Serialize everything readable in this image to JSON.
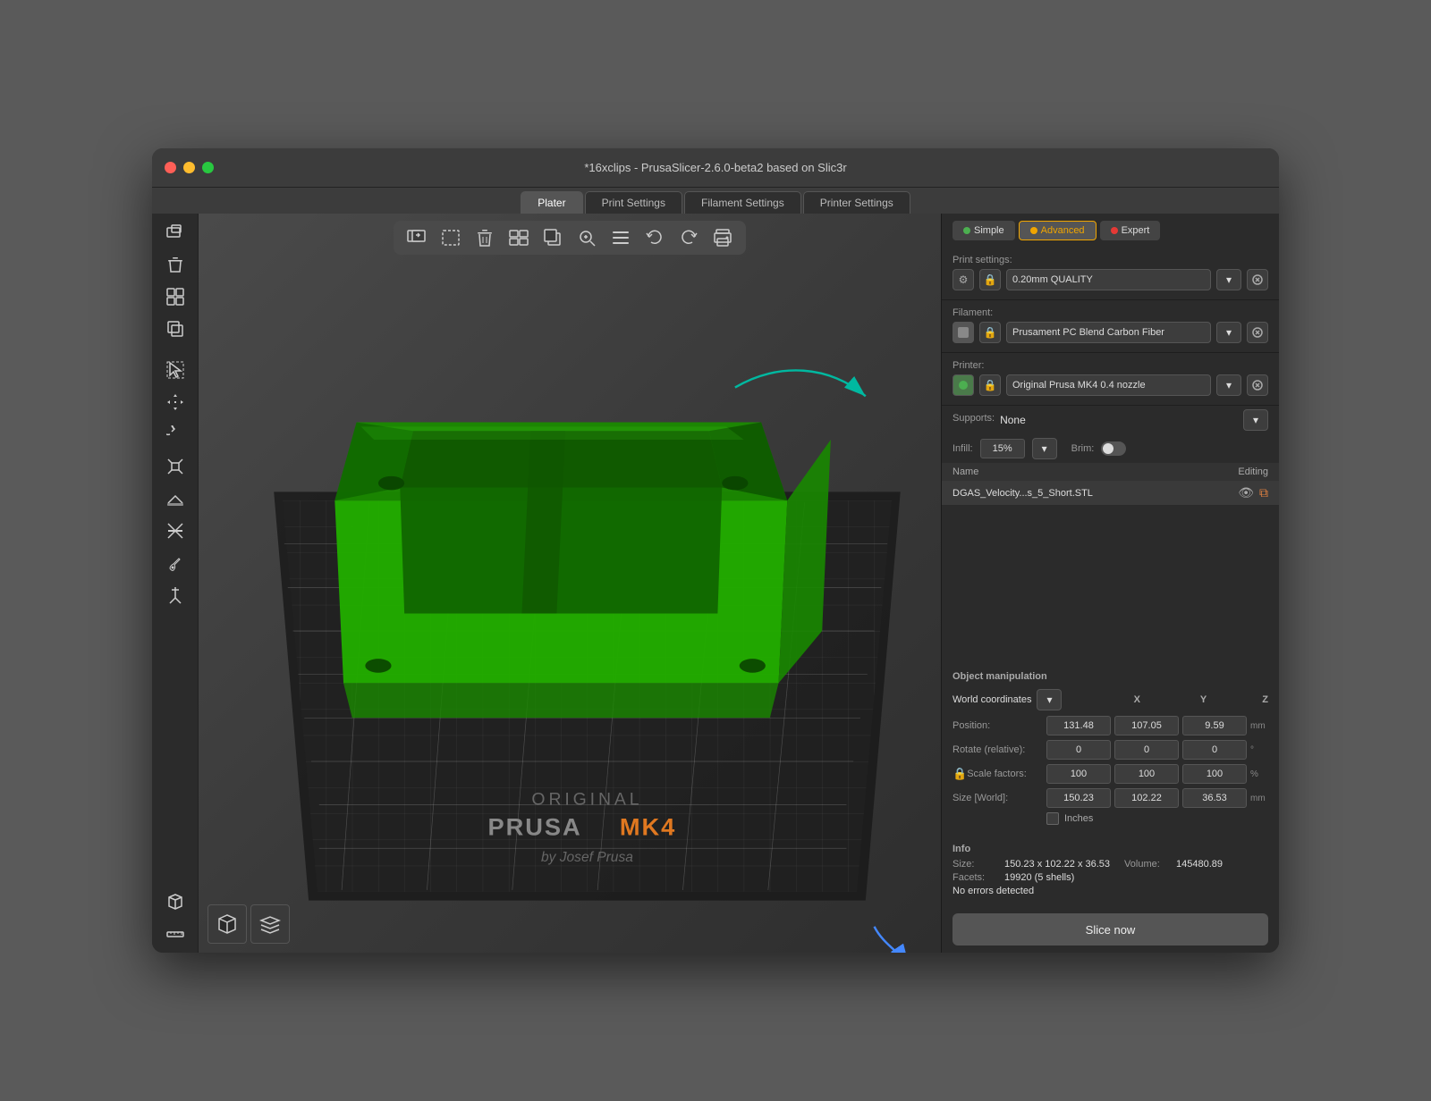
{
  "window": {
    "title": "*16xclips - PrusaSlicer-2.6.0-beta2 based on Slic3r",
    "traffic_lights": [
      "red",
      "yellow",
      "green"
    ]
  },
  "tabs": [
    {
      "id": "plater",
      "label": "Plater",
      "active": true
    },
    {
      "id": "print",
      "label": "Print Settings",
      "active": false
    },
    {
      "id": "filament",
      "label": "Filament Settings",
      "active": false
    },
    {
      "id": "printer",
      "label": "Printer Settings",
      "active": false
    }
  ],
  "mode_buttons": [
    {
      "id": "simple",
      "label": "Simple",
      "dot": "green"
    },
    {
      "id": "advanced",
      "label": "Advanced",
      "dot": "orange",
      "active": true
    },
    {
      "id": "expert",
      "label": "Expert",
      "dot": "red"
    }
  ],
  "print_settings": {
    "label": "Print settings:",
    "value": "0.20mm QUALITY"
  },
  "filament": {
    "label": "Filament:",
    "value": "Prusament PC Blend Carbon Fiber"
  },
  "printer": {
    "label": "Printer:",
    "value": "Original Prusa MK4 0.4 nozzle"
  },
  "supports": {
    "label": "Supports:",
    "value": "None"
  },
  "infill": {
    "label": "Infill:",
    "value": "15%"
  },
  "brim": {
    "label": "Brim:"
  },
  "object_list": {
    "headers": [
      "Name",
      "Editing"
    ],
    "items": [
      {
        "name": "DGAS_Velocity...s_5_Short.STL",
        "visible": true,
        "editing": true
      }
    ]
  },
  "object_manipulation": {
    "title": "Object manipulation",
    "world_coords_label": "World coordinates",
    "coord_headers": [
      "X",
      "Y",
      "Z"
    ],
    "position": {
      "label": "Position:",
      "x": "131.48",
      "y": "107.05",
      "z": "9.59",
      "unit": "mm"
    },
    "rotate": {
      "label": "Rotate (relative):",
      "x": "0",
      "y": "0",
      "z": "0",
      "unit": "°"
    },
    "scale_factors": {
      "label": "Scale factors:",
      "x": "100",
      "y": "100",
      "z": "100",
      "unit": "%"
    },
    "size": {
      "label": "Size [World]:",
      "x": "150.23",
      "y": "102.22",
      "z": "36.53",
      "unit": "mm"
    },
    "inches_label": "Inches"
  },
  "info": {
    "title": "Info",
    "size_label": "Size:",
    "size_value": "150.23 x 102.22 x 36.53",
    "volume_label": "Volume:",
    "volume_value": "145480.89",
    "facets_label": "Facets:",
    "facets_value": "19920 (5 shells)",
    "errors_label": "No errors detected"
  },
  "slice_button": "Slice now",
  "viewport": {
    "prusa_original": "ORIGINAL",
    "prusa_model": "PRUSA",
    "prusa_variant": "MK4",
    "prusa_by": "by Josef Prusa"
  },
  "icons": {
    "cube": "⬜",
    "layers": "▤",
    "eye": "👁",
    "edit": "✏",
    "lock": "🔒",
    "search": "🔍",
    "undo": "↩",
    "redo": "↪",
    "menu": "≡",
    "chevron_down": "▾",
    "settings": "⚙",
    "add": "⊕",
    "subtract": "⊖",
    "copy": "⧉",
    "arrange": "⊞"
  }
}
